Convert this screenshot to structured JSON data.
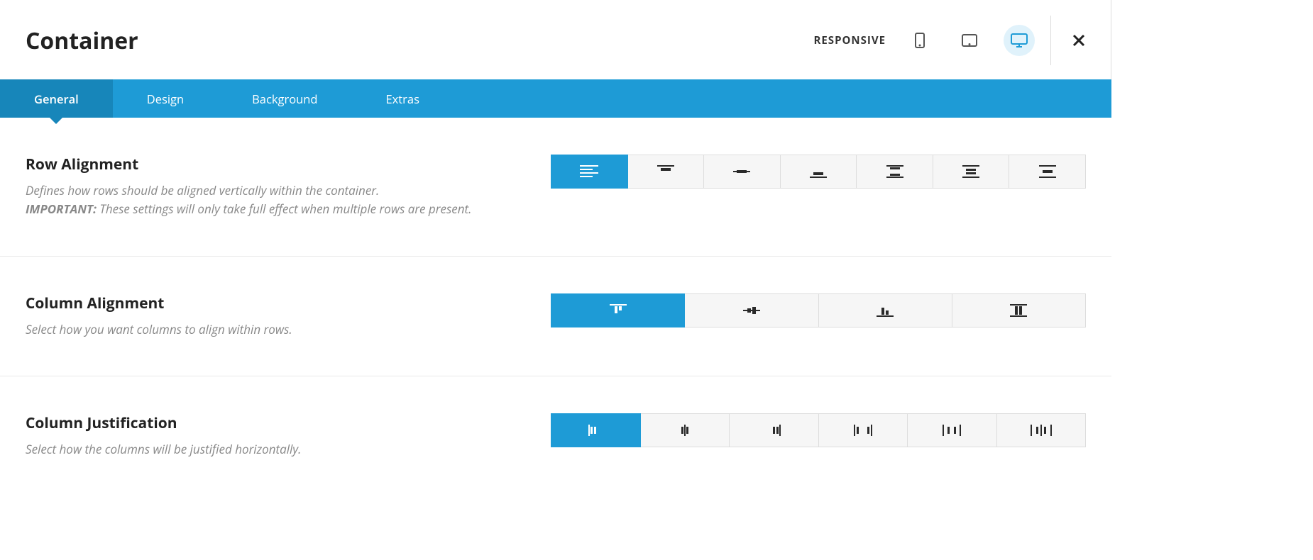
{
  "header": {
    "title": "Container",
    "responsive_label": "RESPONSIVE",
    "devices": [
      {
        "name": "mobile",
        "active": false
      },
      {
        "name": "tablet",
        "active": false
      },
      {
        "name": "desktop",
        "active": true
      }
    ]
  },
  "tabs": [
    {
      "label": "General",
      "active": true
    },
    {
      "label": "Design",
      "active": false
    },
    {
      "label": "Background",
      "active": false
    },
    {
      "label": "Extras",
      "active": false
    }
  ],
  "sections": {
    "row_alignment": {
      "title": "Row Alignment",
      "desc_line1": "Defines how rows should be aligned vertically within the container.",
      "desc_important": "IMPORTANT:",
      "desc_line2": " These settings will only take full effect when multiple rows are present.",
      "options": [
        {
          "name": "stretch",
          "active": true
        },
        {
          "name": "top",
          "active": false
        },
        {
          "name": "center",
          "active": false
        },
        {
          "name": "bottom",
          "active": false
        },
        {
          "name": "space-between",
          "active": false
        },
        {
          "name": "space-around",
          "active": false
        },
        {
          "name": "space-evenly",
          "active": false
        }
      ]
    },
    "column_alignment": {
      "title": "Column Alignment",
      "desc": "Select how you want columns to align within rows.",
      "options": [
        {
          "name": "top",
          "active": true
        },
        {
          "name": "center",
          "active": false
        },
        {
          "name": "bottom",
          "active": false
        },
        {
          "name": "stretch",
          "active": false
        }
      ]
    },
    "column_justification": {
      "title": "Column Justification",
      "desc": "Select how the columns will be justified horizontally.",
      "options": [
        {
          "name": "start",
          "active": true
        },
        {
          "name": "center",
          "active": false
        },
        {
          "name": "end",
          "active": false
        },
        {
          "name": "space-between",
          "active": false
        },
        {
          "name": "space-around",
          "active": false
        },
        {
          "name": "space-evenly",
          "active": false
        }
      ]
    }
  },
  "colors": {
    "accent": "#1e9bd6",
    "accent_dark": "#1786ba"
  }
}
